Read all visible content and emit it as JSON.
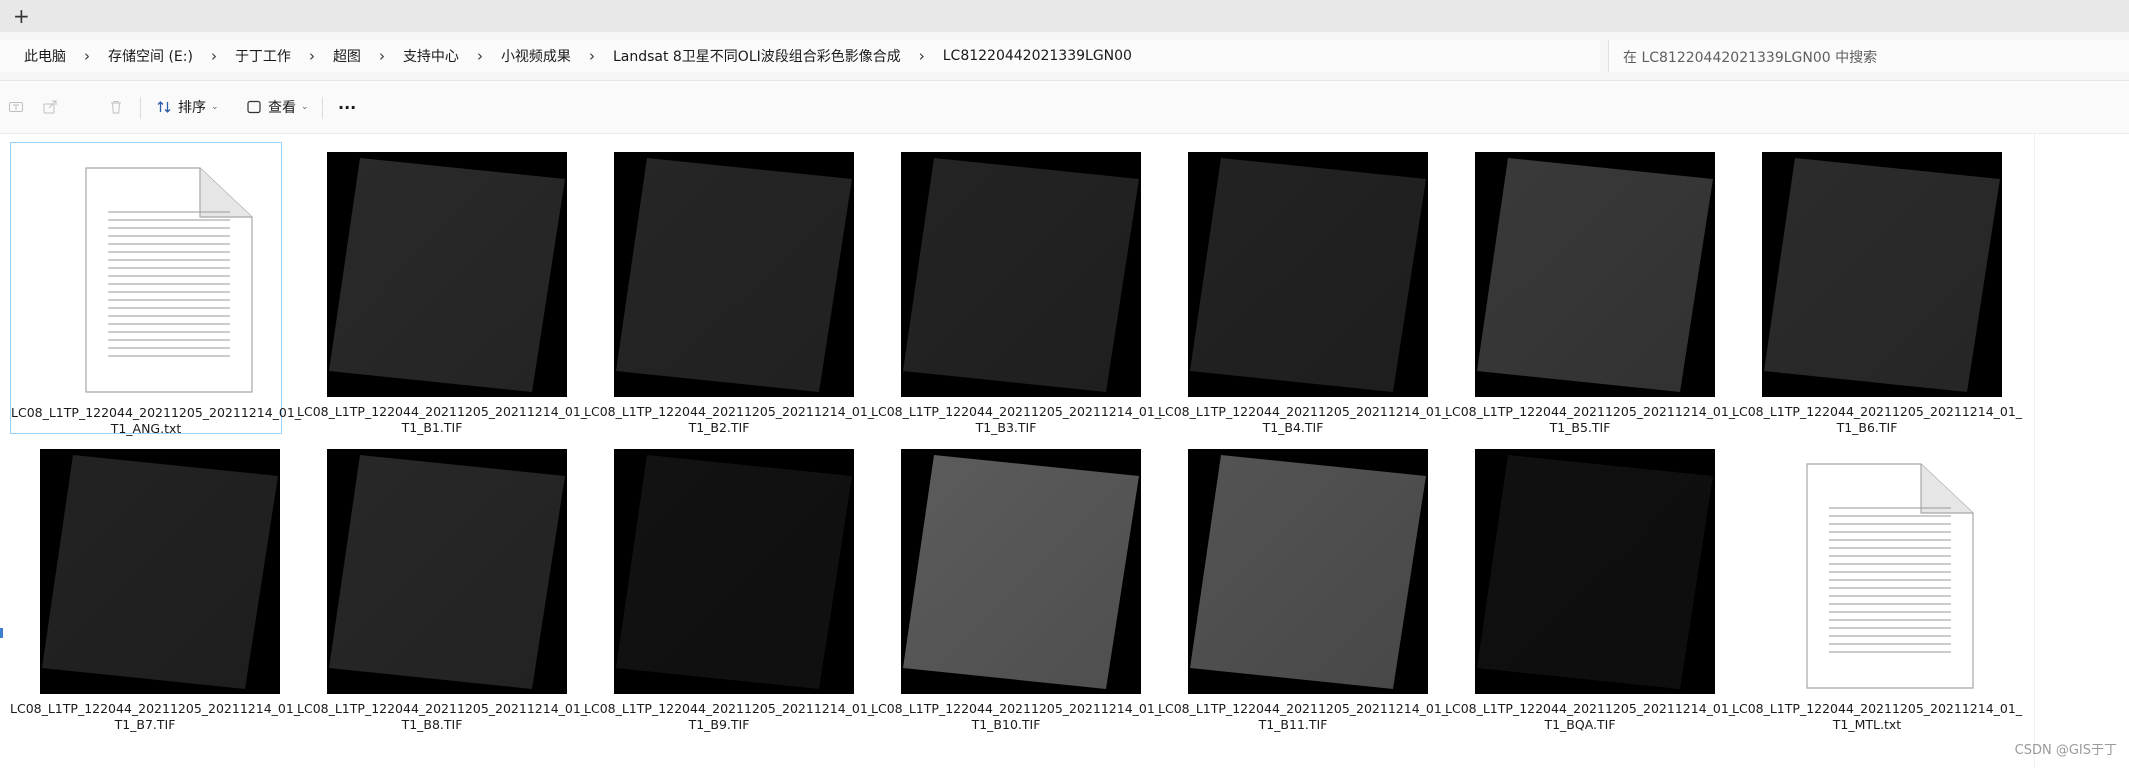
{
  "tabbar": {
    "new_tab_label": "+"
  },
  "breadcrumb": [
    "此电脑",
    "存储空间 (E:)",
    "于丁工作",
    "超图",
    "支持中心",
    "小视频成果",
    "Landsat 8卫星不同OLI波段组合彩色影像合成",
    "LC81220442021339LGN00"
  ],
  "search": {
    "placeholder": "在 LC81220442021339LGN00 中搜索"
  },
  "toolbar": {
    "sort_label": "排序",
    "view_label": "查看",
    "more_label": "···"
  },
  "files": [
    {
      "name": "LC08_L1TP_122044_20211205_20211214_01_T1_ANG.txt",
      "line1": "LC08_L1TP_122044_20211205_20211214_01_",
      "line2": "T1_ANG.txt",
      "kind": "text",
      "selected": true
    },
    {
      "name": "LC08_L1TP_122044_20211205_20211214_01_T1_B1.TIF",
      "line1": "LC08_L1TP_122044_20211205_20211214_01_",
      "line2": "T1_B1.TIF",
      "kind": "raster",
      "tone": "#2a2a2a"
    },
    {
      "name": "LC08_L1TP_122044_20211205_20211214_01_T1_B2.TIF",
      "line1": "LC08_L1TP_122044_20211205_20211214_01_",
      "line2": "T1_B2.TIF",
      "kind": "raster",
      "tone": "#262626"
    },
    {
      "name": "LC08_L1TP_122044_20211205_20211214_01_T1_B3.TIF",
      "line1": "LC08_L1TP_122044_20211205_20211214_01_",
      "line2": "T1_B3.TIF",
      "kind": "raster",
      "tone": "#242424"
    },
    {
      "name": "LC08_L1TP_122044_20211205_20211214_01_T1_B4.TIF",
      "line1": "LC08_L1TP_122044_20211205_20211214_01_",
      "line2": "T1_B4.TIF",
      "kind": "raster",
      "tone": "#232323"
    },
    {
      "name": "LC08_L1TP_122044_20211205_20211214_01_T1_B5.TIF",
      "line1": "LC08_L1TP_122044_20211205_20211214_01_",
      "line2": "T1_B5.TIF",
      "kind": "raster",
      "tone": "#3a3a3a"
    },
    {
      "name": "LC08_L1TP_122044_20211205_20211214_01_T1_B6.TIF",
      "line1": "LC08_L1TP_122044_20211205_20211214_01_",
      "line2": "T1_B6.TIF",
      "kind": "raster",
      "tone": "#2c2c2c"
    },
    {
      "name": "LC08_L1TP_122044_20211205_20211214_01_T1_B7.TIF",
      "line1": "LC08_L1TP_122044_20211205_20211214_01_",
      "line2": "T1_B7.TIF",
      "kind": "raster",
      "tone": "#232323"
    },
    {
      "name": "LC08_L1TP_122044_20211205_20211214_01_T1_B8.TIF",
      "line1": "LC08_L1TP_122044_20211205_20211214_01_",
      "line2": "T1_B8.TIF",
      "kind": "raster",
      "tone": "#282828"
    },
    {
      "name": "LC08_L1TP_122044_20211205_20211214_01_T1_B9.TIF",
      "line1": "LC08_L1TP_122044_20211205_20211214_01_",
      "line2": "T1_B9.TIF",
      "kind": "raster",
      "tone": "#121212"
    },
    {
      "name": "LC08_L1TP_122044_20211205_20211214_01_T1_B10.TIF",
      "line1": "LC08_L1TP_122044_20211205_20211214_01_",
      "line2": "T1_B10.TIF",
      "kind": "raster",
      "tone": "#5c5c5c"
    },
    {
      "name": "LC08_L1TP_122044_20211205_20211214_01_T1_B11.TIF",
      "line1": "LC08_L1TP_122044_20211205_20211214_01_",
      "line2": "T1_B11.TIF",
      "kind": "raster",
      "tone": "#545454"
    },
    {
      "name": "LC08_L1TP_122044_20211205_20211214_01_T1_BQA.TIF",
      "line1": "LC08_L1TP_122044_20211205_20211214_01_",
      "line2": "T1_BQA.TIF",
      "kind": "raster",
      "tone": "#101010"
    },
    {
      "name": "LC08_L1TP_122044_20211205_20211214_01_T1_MTL.txt",
      "line1": "LC08_L1TP_122044_20211205_20211214_01_",
      "line2": "T1_MTL.txt",
      "kind": "text"
    }
  ],
  "watermark": "CSDN @GIS于丁"
}
